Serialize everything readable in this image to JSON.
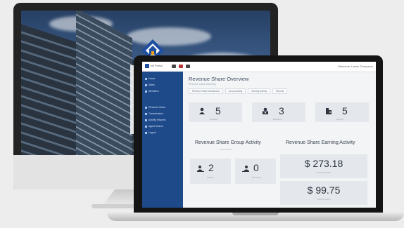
{
  "app": {
    "brand": "eB Portal",
    "welcome": "Welcome, Lance Thompson"
  },
  "sidebar": {
    "items": [
      {
        "label": "Home"
      },
      {
        "label": "Sales"
      },
      {
        "label": "Members"
      },
      {
        "label": "Revenue Share"
      },
      {
        "label": "Commissions"
      },
      {
        "label": "Activity Reports"
      },
      {
        "label": "Agent Search"
      },
      {
        "label": "Logout"
      }
    ]
  },
  "page": {
    "title": "Revenue Share Overview",
    "subtitle": "Revenue share summary",
    "tabs": [
      "Revenue Share Dashboard",
      "Group Activity",
      "Earning Activity",
      "Reports"
    ]
  },
  "stats": [
    {
      "value": "5",
      "caption": "Enrolled",
      "icon": "person-icon"
    },
    {
      "value": "3",
      "caption": "Members",
      "icon": "user-badge-icon"
    },
    {
      "value": "5",
      "caption": "Groups",
      "icon": "building-icon"
    }
  ],
  "group_activity": {
    "title": "Revenue Share Group Activity",
    "subtitle": "Last 30 days",
    "cards": [
      {
        "value": "2",
        "caption": "Added",
        "icon": "person-add-icon"
      },
      {
        "value": "0",
        "caption": "Removed",
        "icon": "person-remove-icon"
      }
    ]
  },
  "earning_activity": {
    "title": "Revenue Share Earning Activity",
    "cards": [
      {
        "value": "$ 273.18",
        "caption": "Earned to date"
      },
      {
        "value": "$ 99.75",
        "caption": "Current month"
      }
    ]
  },
  "colors": {
    "sidebar": "#1f4a8a",
    "card": "#e4e7eb",
    "text": "#2f3642"
  }
}
